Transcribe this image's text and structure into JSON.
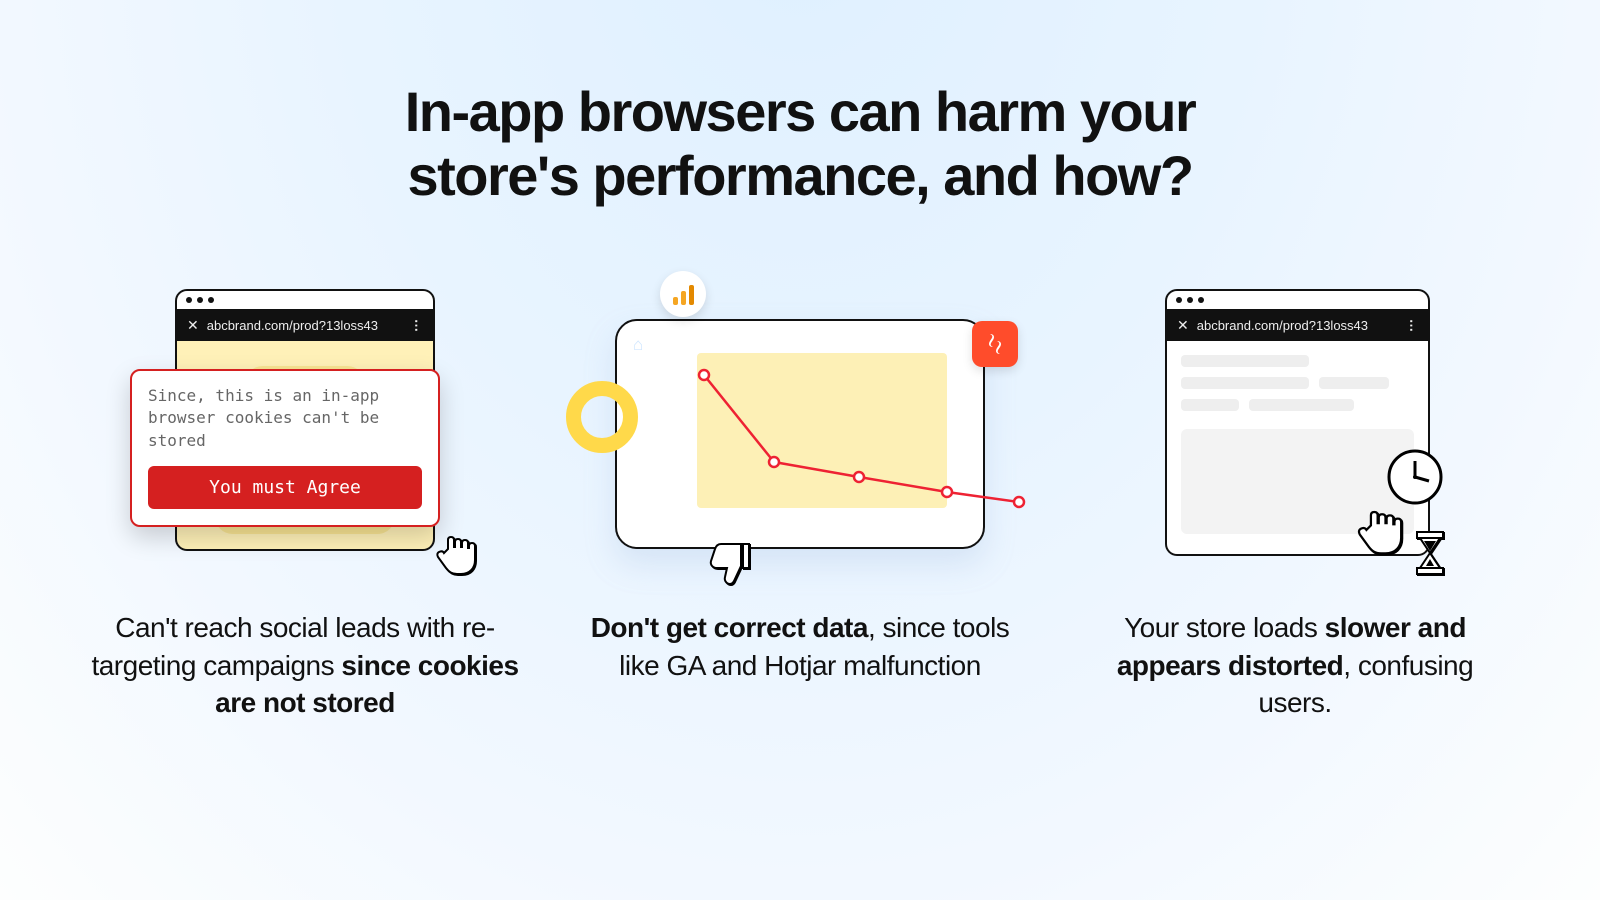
{
  "heading_l1": "In-app browsers can harm your",
  "heading_l2": "store's performance, and how?",
  "panels": {
    "p1": {
      "url": "abcbrand.com/prod?13loss43",
      "alert_msg": "Since, this is an in-app browser cookies can't be stored",
      "alert_btn": "You must Agree",
      "cap_a": "Can't reach social leads with re-targeting campaigns ",
      "cap_b": "since cookies are not stored"
    },
    "p2": {
      "cap_a": "Don't get correct data",
      "cap_b": ", since tools like GA and Hotjar malfunction"
    },
    "p3": {
      "url": "abcbrand.com/prod?13loss43",
      "cap_a": "Your store loads ",
      "cap_b": "slower and appears distorted",
      "cap_c": ", confusing users."
    }
  },
  "chart_data": {
    "type": "line",
    "title": "",
    "xlabel": "",
    "ylabel": "",
    "x": [
      0,
      1,
      2,
      3,
      4
    ],
    "values": [
      100,
      45,
      38,
      30,
      25
    ],
    "ylim": [
      0,
      100
    ],
    "note": "Downward-trending metric line illustrating analytics malfunction; values are relative heights estimated from the graphic."
  }
}
